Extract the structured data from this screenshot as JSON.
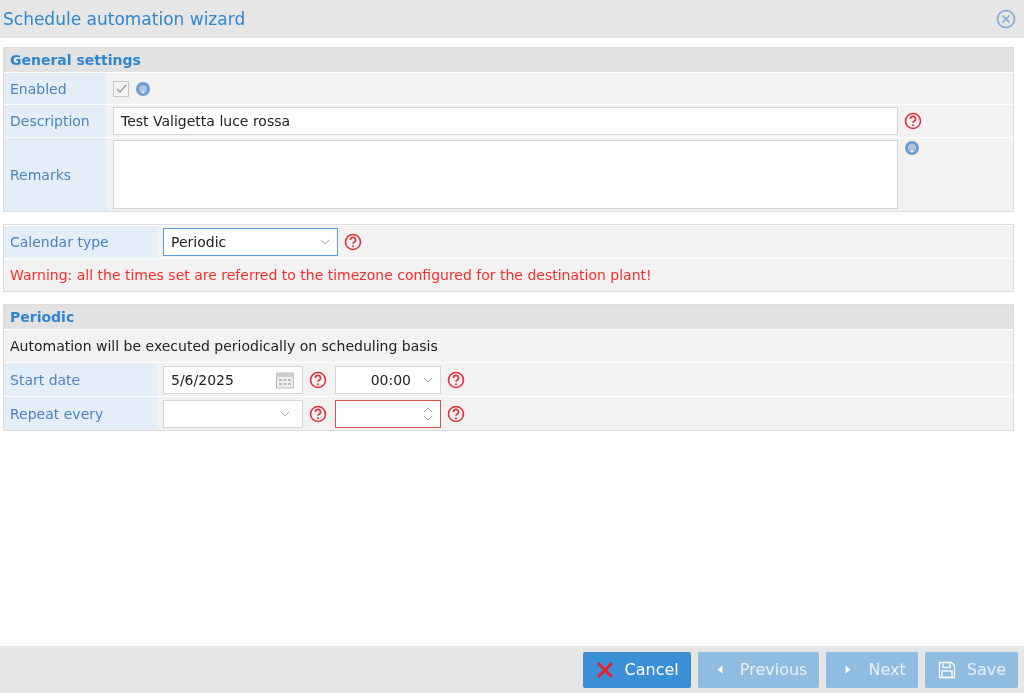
{
  "window": {
    "title": "Schedule automation wizard"
  },
  "general_settings": {
    "title": "General settings",
    "enabled": {
      "label": "Enabled",
      "checked": true,
      "disabled": true,
      "required": false
    },
    "description": {
      "label": "Description",
      "value": "Test Valigetta luce rossa",
      "required": true
    },
    "remarks": {
      "label": "Remarks",
      "required": false
    }
  },
  "calendar": {
    "label": "Calendar type",
    "value": "Periodic",
    "required": true,
    "warning": "Warning: all the times set are referred to the timezone configured for the destination plant!"
  },
  "periodic": {
    "title": "Periodic",
    "note": "Automation will be executed periodically on scheduling basis",
    "start_date": {
      "label": "Start date",
      "date": "5/6/2025",
      "date_required": true,
      "time": "00:00",
      "time_required": true
    },
    "repeat_every": {
      "label": "Repeat every",
      "unit_required": true,
      "count_invalid": true,
      "count_required": true
    }
  },
  "buttons": [
    {
      "label": "Cancel",
      "kind": "cancel",
      "disabled": false
    },
    {
      "label": "Previous",
      "kind": "previous",
      "disabled": true
    },
    {
      "label": "Next",
      "kind": "next",
      "disabled": true
    },
    {
      "label": "Save",
      "kind": "save",
      "disabled": true
    }
  ]
}
